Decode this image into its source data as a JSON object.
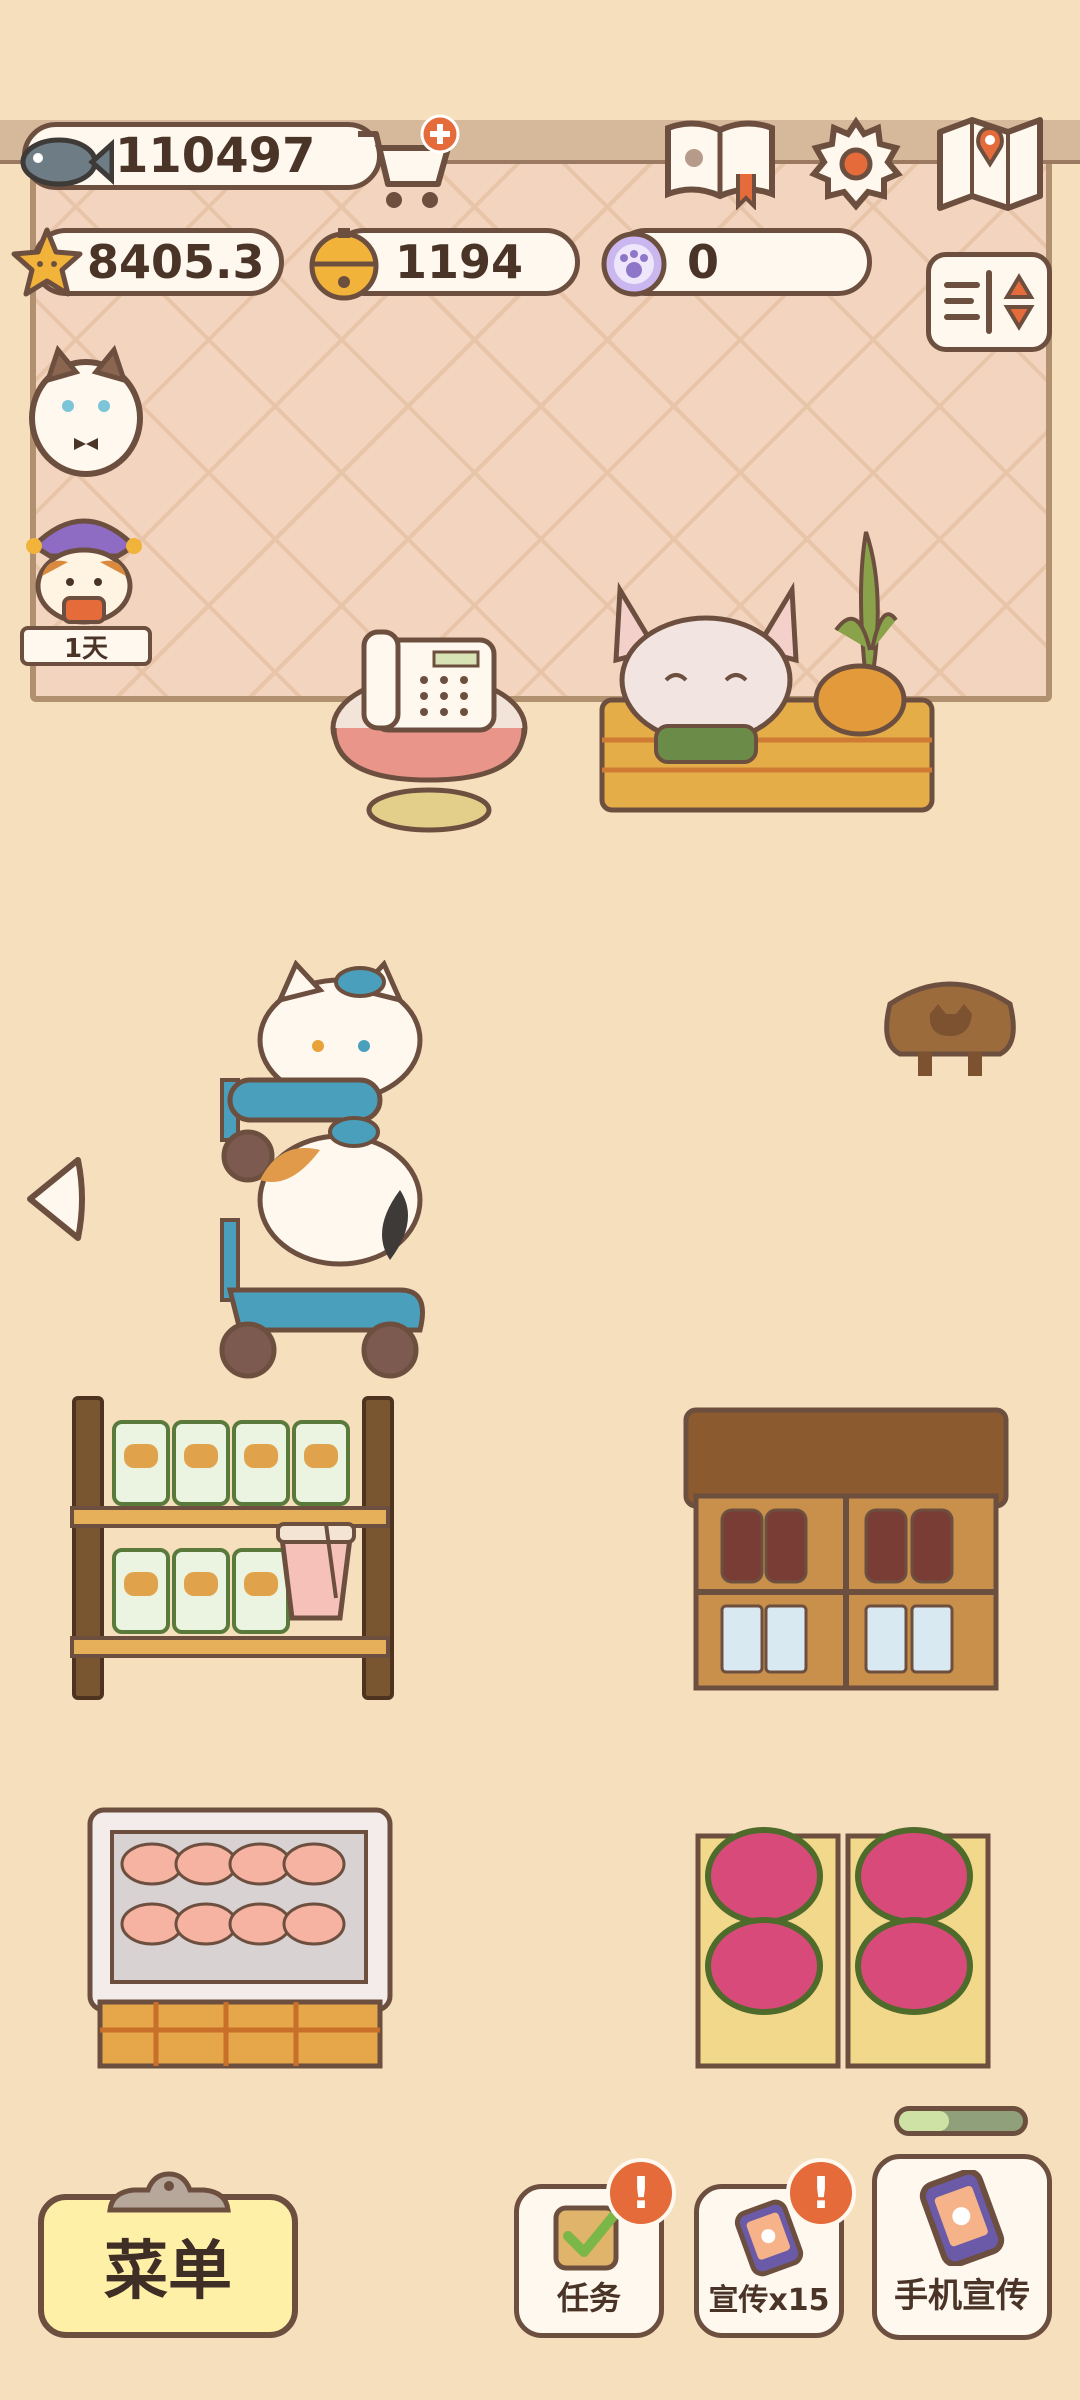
{
  "currencies": {
    "fish": "110497",
    "stars": "8405.3",
    "bells": "1194",
    "paw_coins": "0"
  },
  "side": {
    "event_timer": "1天"
  },
  "bottom": {
    "menu_label": "菜单",
    "task_label": "任务",
    "promote_label": "宣传x15",
    "phone_promote_label": "手机宣传",
    "task_badge": "!",
    "promote_badge": "!"
  },
  "colors": {
    "accent_orange": "#e56b3a",
    "menu_yellow": "#fff0a8",
    "outline_brown": "#6d4f3f"
  }
}
